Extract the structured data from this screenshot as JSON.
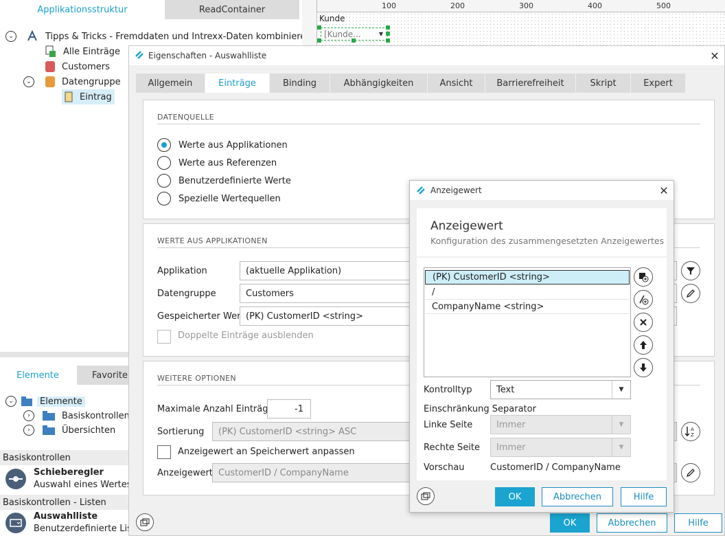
{
  "left_panel": {
    "tabs": [
      "Applikationsstruktur",
      "ReadContainer"
    ],
    "tree": [
      {
        "label": "Tipps & Tricks - Fremddaten und Intrexx-Daten kombinieren"
      },
      {
        "label": "Alle Einträge"
      },
      {
        "label": "Customers"
      },
      {
        "label": "Datengruppe"
      },
      {
        "label": "Eintrag"
      }
    ],
    "element_tabs": [
      "Elemente",
      "Favoriten"
    ],
    "element_tree": [
      "Elemente",
      "Basiskontrollen",
      "Übersichten"
    ],
    "sections": [
      {
        "header": "Basiskontrollen",
        "title": "Schieberegler",
        "desc": "Auswahl eines Wertes a"
      },
      {
        "header": "Basiskontrollen - Listen",
        "title": "Auswahlliste",
        "desc": "Benutzerdefinierte Liste"
      }
    ]
  },
  "designer": {
    "ruler": [
      "100",
      "200",
      "300",
      "400",
      "500"
    ],
    "control_label": "Kunde",
    "control_value": "[Kunde..."
  },
  "properties": {
    "title": "Eigenschaften - Auswahlliste",
    "tabs": [
      "Allgemein",
      "Einträge",
      "Binding",
      "Abhängigkeiten",
      "Ansicht",
      "Barrierefreiheit",
      "Skript",
      "Expert"
    ],
    "datasource": {
      "title": "DATENQUELLE",
      "options": [
        "Werte aus Applikationen",
        "Werte aus Referenzen",
        "Benutzerdefinierte Werte",
        "Spezielle Wertequellen"
      ]
    },
    "app_values": {
      "title": "WERTE AUS APPLIKATIONEN",
      "app_label": "Applikation",
      "app_value": "(aktuelle Applikation)",
      "dg_label": "Datengruppe",
      "dg_value": "Customers",
      "saved_label": "Gespeicherter Wert",
      "saved_value": "(PK) CustomerID <string>",
      "dup_label": "Doppelte Einträge ausblenden"
    },
    "more": {
      "title": "WEITERE OPTIONEN",
      "max_label": "Maximale Anzahl Einträge",
      "max_value": "-1",
      "sort_label": "Sortierung",
      "sort_value": "(PK) CustomerID <string> ASC",
      "adapt_label": "Anzeigewert an Speicherwert anpassen",
      "display_label": "Anzeigewert",
      "display_value": "CustomerID / CompanyName"
    },
    "buttons": {
      "ok": "OK",
      "cancel": "Abbrechen",
      "help": "Hilfe"
    }
  },
  "anzeigewert": {
    "title": "Anzeigewert",
    "heading": "Anzeigewert",
    "subheading": "Konfiguration des zusammengesetzten Anzeigewertes",
    "items": [
      "(PK) CustomerID <string>",
      "/",
      "CompanyName <string>"
    ],
    "control_type_label": "Kontrolltyp",
    "control_type_value": "Text",
    "restriction_label": "Einschränkung Separator",
    "left_label": "Linke Seite",
    "left_value": "Immer",
    "right_label": "Rechte Seite",
    "right_value": "Immer",
    "preview_label": "Vorschau",
    "preview_value": "CustomerID / CompanyName",
    "buttons": {
      "ok": "OK",
      "cancel": "Abbrechen",
      "help": "Hilfe"
    }
  },
  "colors": {
    "accent": "#1ba4cf",
    "tab_inactive": "#dcdcdc"
  }
}
